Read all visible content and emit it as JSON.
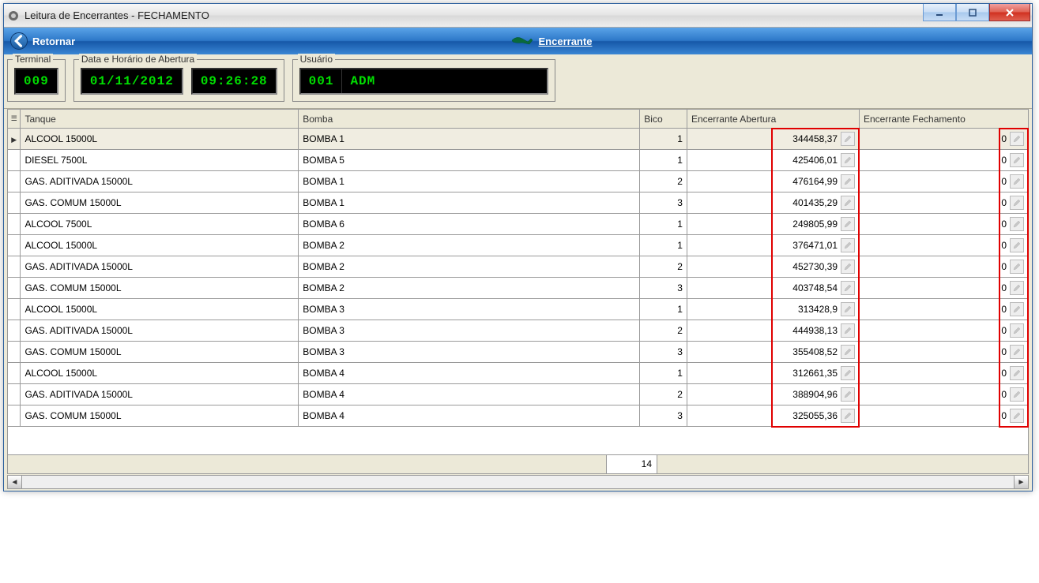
{
  "window": {
    "title": "Leitura de Encerrantes - FECHAMENTO"
  },
  "toolbar": {
    "back_label": "Retornar",
    "encerrante_label": "Encerrante"
  },
  "info": {
    "terminal_legend": "Terminal",
    "terminal_value": "009",
    "datetime_legend": "Data e Horário de Abertura",
    "date_value": "01/11/2012",
    "time_value": "09:26:28",
    "user_legend": "Usuário",
    "user_code": "001",
    "user_name": "ADM"
  },
  "grid": {
    "columns": {
      "tanque": "Tanque",
      "bomba": "Bomba",
      "bico": "Bico",
      "abertura": "Encerrante Abertura",
      "fechamento": "Encerrante Fechamento"
    },
    "rows": [
      {
        "tanque": "ALCOOL 15000L",
        "bomba": "BOMBA 1",
        "bico": "1",
        "abertura": "344458,37",
        "fechamento": "0"
      },
      {
        "tanque": "DIESEL 7500L",
        "bomba": "BOMBA 5",
        "bico": "1",
        "abertura": "425406,01",
        "fechamento": "0"
      },
      {
        "tanque": "GAS. ADITIVADA 15000L",
        "bomba": "BOMBA 1",
        "bico": "2",
        "abertura": "476164,99",
        "fechamento": "0"
      },
      {
        "tanque": "GAS. COMUM 15000L",
        "bomba": "BOMBA 1",
        "bico": "3",
        "abertura": "401435,29",
        "fechamento": "0"
      },
      {
        "tanque": "ALCOOL 7500L",
        "bomba": "BOMBA 6",
        "bico": "1",
        "abertura": "249805,99",
        "fechamento": "0"
      },
      {
        "tanque": "ALCOOL 15000L",
        "bomba": "BOMBA 2",
        "bico": "1",
        "abertura": "376471,01",
        "fechamento": "0"
      },
      {
        "tanque": "GAS. ADITIVADA 15000L",
        "bomba": "BOMBA 2",
        "bico": "2",
        "abertura": "452730,39",
        "fechamento": "0"
      },
      {
        "tanque": "GAS. COMUM 15000L",
        "bomba": "BOMBA 2",
        "bico": "3",
        "abertura": "403748,54",
        "fechamento": "0"
      },
      {
        "tanque": "ALCOOL 15000L",
        "bomba": "BOMBA 3",
        "bico": "1",
        "abertura": "313428,9",
        "fechamento": "0"
      },
      {
        "tanque": "GAS. ADITIVADA 15000L",
        "bomba": "BOMBA 3",
        "bico": "2",
        "abertura": "444938,13",
        "fechamento": "0"
      },
      {
        "tanque": "GAS. COMUM 15000L",
        "bomba": "BOMBA 3",
        "bico": "3",
        "abertura": "355408,52",
        "fechamento": "0"
      },
      {
        "tanque": "ALCOOL 15000L",
        "bomba": "BOMBA 4",
        "bico": "1",
        "abertura": "312661,35",
        "fechamento": "0"
      },
      {
        "tanque": "GAS. ADITIVADA 15000L",
        "bomba": "BOMBA 4",
        "bico": "2",
        "abertura": "388904,96",
        "fechamento": "0"
      },
      {
        "tanque": "GAS. COMUM 15000L",
        "bomba": "BOMBA 4",
        "bico": "3",
        "abertura": "325055,36",
        "fechamento": "0"
      }
    ],
    "row_count": "14"
  }
}
